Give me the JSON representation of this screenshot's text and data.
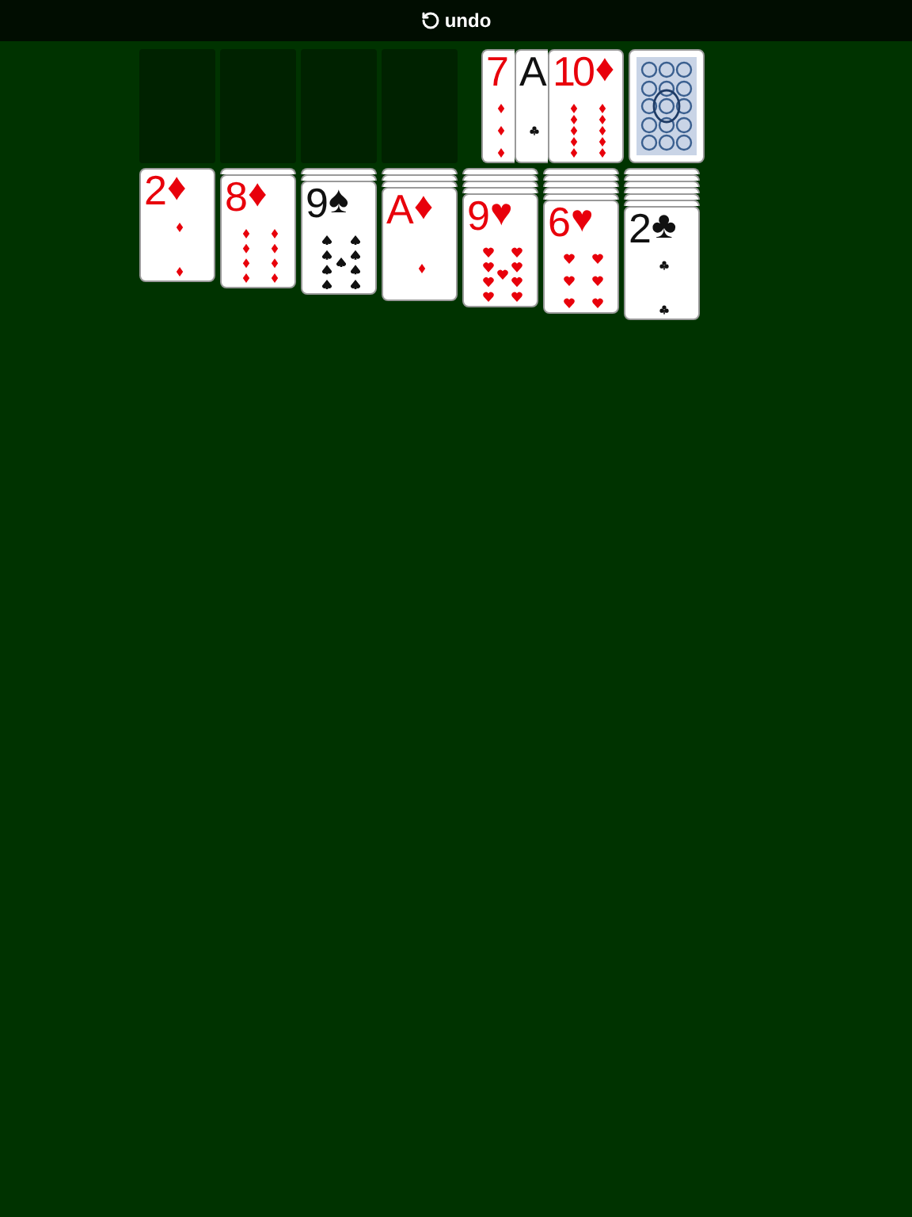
{
  "toolbar": {
    "undo": "undo"
  },
  "foundations": [
    {
      "kind": "empty"
    },
    {
      "kind": "empty"
    },
    {
      "kind": "empty"
    },
    {
      "kind": "empty"
    }
  ],
  "waste": [
    {
      "kind": "diamonds",
      "rank": "7",
      "color": "#e8000b"
    },
    {
      "kind": "clubs",
      "rank": "A",
      "color": "#111111"
    },
    {
      "kind": "diamonds",
      "rank": "10",
      "suit": "♦",
      "color": "#e8000b"
    }
  ],
  "stock": {
    "kind": "face_down"
  },
  "tableau": [
    {
      "cards": [
        {
          "kind": "diamonds",
          "rank": "2",
          "suit": "♦",
          "color": "#e8000b"
        }
      ]
    },
    {
      "cards": [
        {
          "kind": "face_down"
        },
        {
          "kind": "diamonds",
          "rank": "8",
          "suit": "♦",
          "color": "#e8000b"
        }
      ]
    },
    {
      "cards": [
        {
          "kind": "face_down"
        },
        {
          "kind": "face_down"
        },
        {
          "kind": "spades",
          "rank": "9",
          "suit": "♠",
          "color": "#111111"
        }
      ]
    },
    {
      "cards": [
        {
          "kind": "face_down"
        },
        {
          "kind": "face_down"
        },
        {
          "kind": "face_down"
        },
        {
          "kind": "diamonds",
          "rank": "A",
          "suit": "♦",
          "color": "#e8000b"
        }
      ]
    },
    {
      "cards": [
        {
          "kind": "face_down"
        },
        {
          "kind": "face_down"
        },
        {
          "kind": "face_down"
        },
        {
          "kind": "face_down"
        },
        {
          "kind": "hearts",
          "rank": "9",
          "suit": "♥",
          "color": "#e8000b"
        }
      ]
    },
    {
      "cards": [
        {
          "kind": "face_down"
        },
        {
          "kind": "face_down"
        },
        {
          "kind": "face_down"
        },
        {
          "kind": "face_down"
        },
        {
          "kind": "face_down"
        },
        {
          "kind": "hearts",
          "rank": "6",
          "suit": "♥",
          "color": "#e8000b"
        }
      ]
    },
    {
      "cards": [
        {
          "kind": "face_down"
        },
        {
          "kind": "face_down"
        },
        {
          "kind": "face_down"
        },
        {
          "kind": "face_down"
        },
        {
          "kind": "face_down"
        },
        {
          "kind": "face_down"
        },
        {
          "kind": "clubs",
          "rank": "2",
          "suit": "♣",
          "color": "#111111"
        }
      ]
    }
  ]
}
